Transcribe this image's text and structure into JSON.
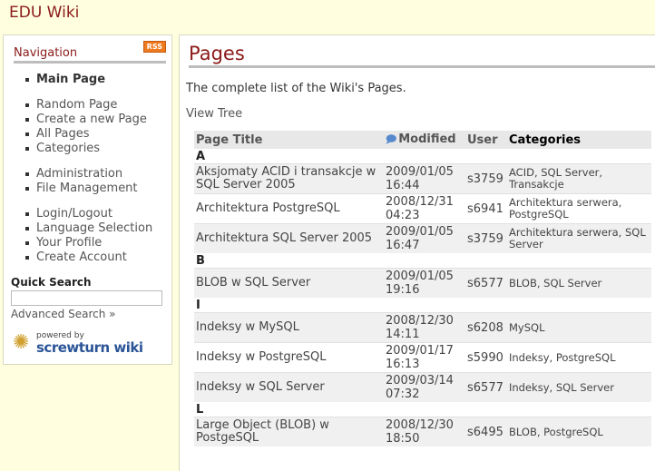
{
  "site": {
    "title": "EDU Wiki"
  },
  "sidebar": {
    "header": "Navigation",
    "rss_label": "RSS",
    "items": [
      {
        "label": "Main Page"
      },
      {
        "label": "Random Page"
      },
      {
        "label": "Create a new Page"
      },
      {
        "label": "All Pages"
      },
      {
        "label": "Categories"
      },
      {
        "label": "Administration"
      },
      {
        "label": "File Management"
      },
      {
        "label": "Login/Logout"
      },
      {
        "label": "Language Selection"
      },
      {
        "label": "Your Profile"
      },
      {
        "label": "Create Account"
      }
    ],
    "quick_search_label": "Quick Search",
    "quick_search_value": "",
    "advanced_search": "Advanced Search »",
    "powered_small": "powered by",
    "powered_brand": "screwturn wiki"
  },
  "main": {
    "title": "Pages",
    "description": "The complete list of the Wiki's Pages.",
    "view_tree": "View Tree",
    "table": {
      "headers": {
        "title": "Page Title",
        "modified": "Modified",
        "user": "User",
        "categories": "Categories"
      },
      "groups": [
        {
          "letter": "A",
          "rows": [
            {
              "title": "Aksjomaty ACID i transakcje w SQL Server 2005",
              "date": "2009/01/05",
              "time": "16:44",
              "user": "s3759",
              "categories": "ACID, SQL Server, Transakcje"
            },
            {
              "title": "Architektura PostgreSQL",
              "date": "2008/12/31",
              "time": "04:23",
              "user": "s6941",
              "categories": "Architektura serwera, PostgreSQL"
            },
            {
              "title": "Architektura SQL Server 2005",
              "date": "2009/01/05",
              "time": "16:47",
              "user": "s3759",
              "categories": "Architektura serwera, SQL Server"
            }
          ]
        },
        {
          "letter": "B",
          "rows": [
            {
              "title": "BLOB w SQL Server",
              "date": "2009/01/05",
              "time": "19:16",
              "user": "s6577",
              "categories": "BLOB, SQL Server"
            }
          ]
        },
        {
          "letter": "I",
          "rows": [
            {
              "title": "Indeksy w MySQL",
              "date": "2008/12/30",
              "time": "14:11",
              "user": "s6208",
              "categories": "MySQL"
            },
            {
              "title": "Indeksy w PostgreSQL",
              "date": "2009/01/17",
              "time": "16:13",
              "user": "s5990",
              "categories": "Indeksy, PostgreSQL"
            },
            {
              "title": "Indeksy w SQL Server",
              "date": "2009/03/14",
              "time": "07:32",
              "user": "s6577",
              "categories": "Indeksy, SQL Server"
            }
          ]
        },
        {
          "letter": "L",
          "rows": [
            {
              "title": "Large Object (BLOB) w PostgeSQL",
              "date": "2008/12/30",
              "time": "18:50",
              "user": "s6495",
              "categories": "BLOB, PostgreSQL"
            }
          ]
        }
      ]
    }
  }
}
